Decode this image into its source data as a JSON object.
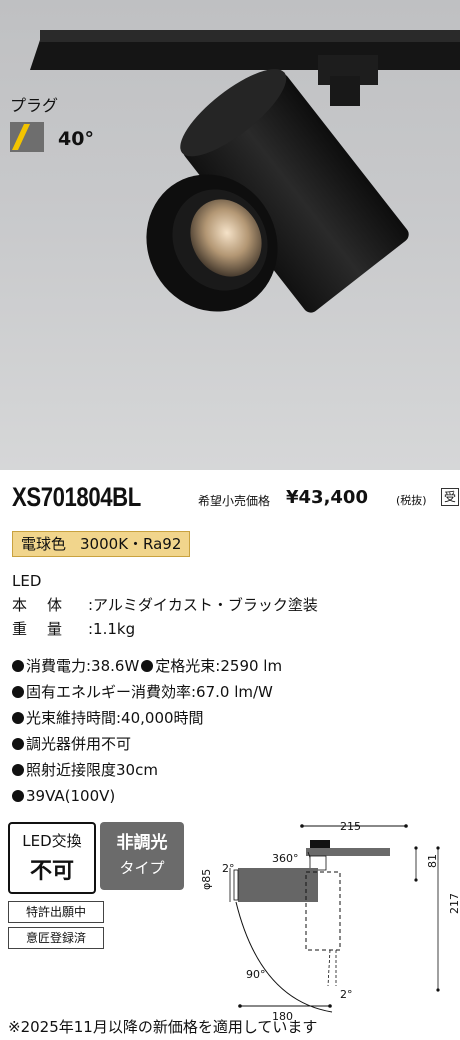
{
  "photo": {
    "plug_label": "プラグ",
    "beam_angle": "40°",
    "beam_icon": "yellow-wedge-icon"
  },
  "product": {
    "model": "XS701804BL",
    "price_label": "希望小売価格",
    "price": "¥43,400",
    "price_tax": "(税抜)",
    "made_badge": "受"
  },
  "color_badge": {
    "name": "電球色",
    "spec": "3000K・Ra92"
  },
  "specs": {
    "light_source": "LED",
    "body_key": "本体",
    "body_value": ":アルミダイカスト・ブラック塗装",
    "weight_key": "重量",
    "weight_value": ":1.1kg"
  },
  "bullets": {
    "power": "消費電力:38.6W",
    "flux": "定格光束:2590 lm",
    "efficiency": "固有エネルギー消費効率:67.0 lm/W",
    "life": "光束維持時間:40,000時間",
    "dimmer": "調光器併用不可",
    "distance": "照射近接限度30cm",
    "va": "39VA(100V)"
  },
  "badges": {
    "led_line1": "LED交換",
    "led_line2": "不可",
    "nondim_line1": "非調光",
    "nondim_line2": "タイプ",
    "patent": "特許出願中",
    "design": "意匠登録済"
  },
  "drawing": {
    "width_top": "215",
    "rotation": "360°",
    "tilt_small": "2°",
    "diameter": "φ85",
    "height_right_small": "81",
    "height_right_total": "217",
    "arc_angle": "90°",
    "bottom_tilt": "2°",
    "width_bottom": "180"
  },
  "footer": {
    "note": "※2025年11月以降の新価格を適用しています"
  },
  "colors": {
    "badge_fill": "#f1d58c",
    "fixture_black": "#1b1b1b",
    "nondim_gray": "#6b6b6b"
  }
}
